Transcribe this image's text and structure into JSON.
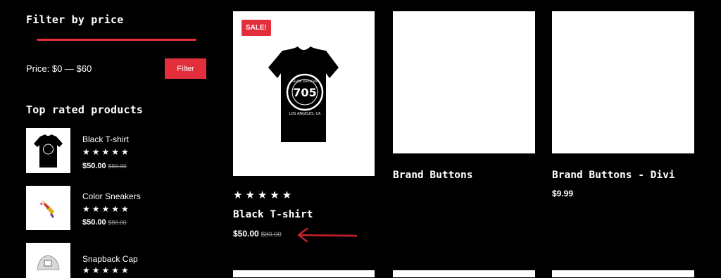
{
  "sidebar": {
    "filter_title": "Filter by price",
    "price_label": "Price: $0 — $60",
    "filter_button": "Filter",
    "top_rated_title": "Top rated products",
    "products": [
      {
        "name": "Black T-shirt",
        "stars": "★★★★★",
        "price": "$50.00",
        "old_price": "$80.00"
      },
      {
        "name": "Color Sneakers",
        "stars": "★★★★★",
        "price": "$50.00",
        "old_price": "$80.00"
      },
      {
        "name": "Snapback Cap",
        "stars": "★★★★★"
      }
    ]
  },
  "grid": {
    "sale_badge": "SALE!",
    "shirt_print_number": "705",
    "shirt_print_ring": "SEVEN ZERO FIVE",
    "shirt_print_city": "LOS ANGELES, CA",
    "cards": [
      {
        "title": "Black T-shirt",
        "stars": "★★★★★",
        "price": "$50.00",
        "old_price": "$80.00"
      },
      {
        "title": "Brand Buttons"
      },
      {
        "title": "Brand Buttons - Divi",
        "price": "$9.99"
      }
    ]
  },
  "colors": {
    "accent": "#e32f3c",
    "background": "#000000"
  }
}
